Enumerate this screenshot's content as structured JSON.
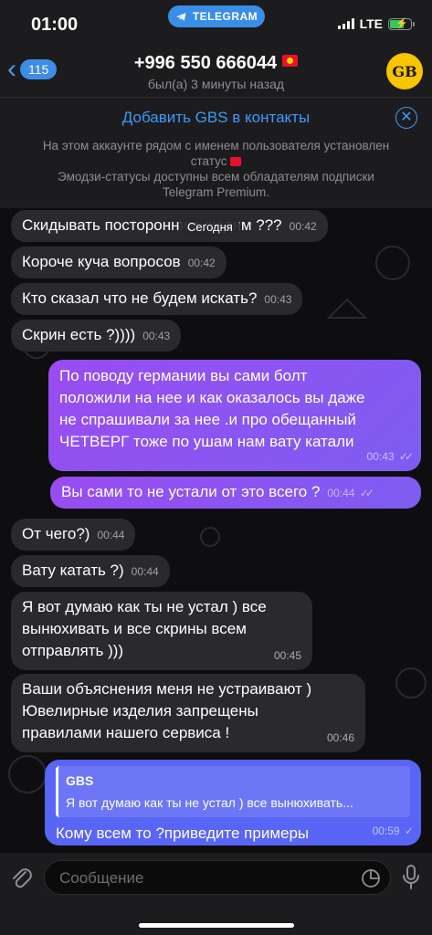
{
  "status_bar": {
    "time": "01:00",
    "app_pill": "TELEGRAM",
    "network": "LTE"
  },
  "header": {
    "back_count": "115",
    "title": "+996 550 666044",
    "subtitle": "был(а) 3 минуты назад",
    "avatar_initials": "GB"
  },
  "banner": {
    "add_contact": "Добавить GBS в контакты",
    "line1": "На этом аккаунте рядом с именем пользователя установлен",
    "line2": "статус",
    "line3": "Эмодзи-статусы доступны всем обладателям подписки",
    "line4": "Telegram Premium."
  },
  "date_pill": "Сегодня",
  "messages": [
    {
      "text": "Скидывать посторонним людям ???",
      "time": "00:42"
    },
    {
      "text": "Короче куча вопросов",
      "time": "00:42"
    },
    {
      "text": "Кто сказал что не будем искать?",
      "time": "00:43"
    },
    {
      "text": "Скрин есть ?))))",
      "time": "00:43"
    },
    {
      "lines": [
        "По поводу германии вы сами болт",
        "положили на нее и как оказалось вы даже",
        "не спрашивали за нее .и про обещанный",
        "ЧЕТВЕРГ тоже по ушам нам вату катали"
      ],
      "time": "00:43"
    },
    {
      "text": "Вы сами то не устали от это всего ?",
      "time": "00:44"
    },
    {
      "text": "От чего?)",
      "time": "00:44"
    },
    {
      "text": "Вату катать ?)",
      "time": "00:44"
    },
    {
      "lines": [
        "Я вот думаю как ты не устал ) все",
        "вынюхивать и все скрины всем",
        "отправлять )))"
      ],
      "time": "00:45"
    },
    {
      "lines": [
        "Ваши объяснения меня не устраивают )",
        "Ювелирные изделия запрещены",
        "правилами нашего сервиса !"
      ],
      "time": "00:46"
    },
    {
      "reply_name": "GBS",
      "reply_text": "Я вот думаю как ты не устал ) все вынюхивать...",
      "text": "Кому всем то ?приведите примеры",
      "time": "00:59"
    }
  ],
  "input": {
    "placeholder": "Сообщение"
  },
  "colors": {
    "accent": "#3e9bf6",
    "outgoing": "#8f52f1",
    "outgoing_last": "#5965f4",
    "incoming": "#2a2a2e"
  }
}
